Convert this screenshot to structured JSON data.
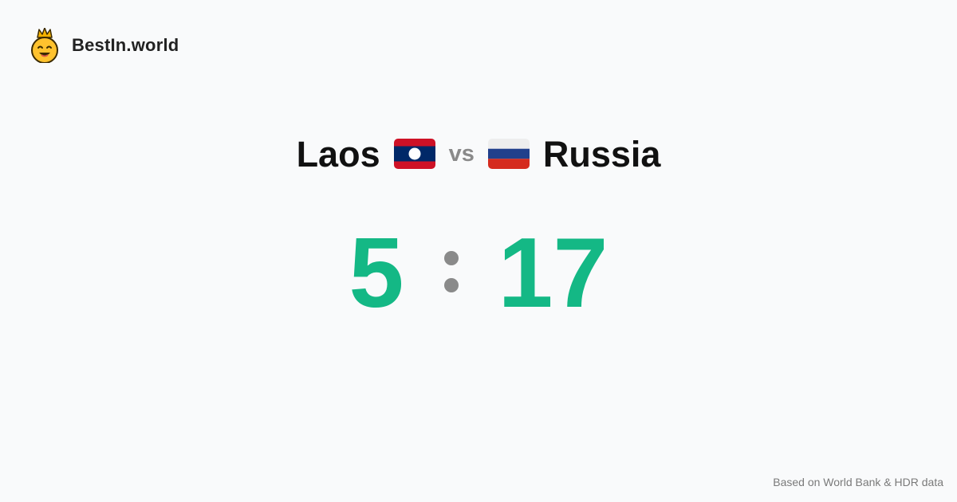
{
  "brand": {
    "name": "BestIn.world",
    "logo_icon": "crowned-smiley-icon"
  },
  "comparison": {
    "left_country": "Laos",
    "left_flag": "laos-flag-icon",
    "vs_label": "vs",
    "right_country": "Russia",
    "right_flag": "russia-flag-icon"
  },
  "score": {
    "left": "5",
    "right": "17"
  },
  "footer": {
    "source": "Based on World Bank & HDR data"
  },
  "colors": {
    "score": "#14b885",
    "muted": "#8a8a8a",
    "background": "#f9fafb"
  }
}
